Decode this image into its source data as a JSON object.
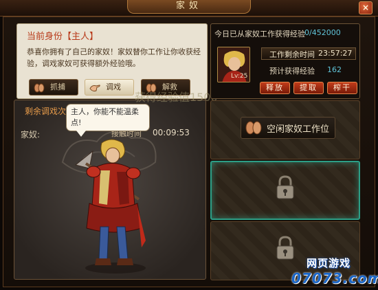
{
  "window": {
    "title": "家奴",
    "close_glyph": "×"
  },
  "info": {
    "identity": "当前身份【主人】",
    "intro": "恭喜你拥有了自己的家奴！家奴替你工作让你收获经验，调戏家奴可获得额外经验哦。"
  },
  "tabs": [
    {
      "label": "抓捕",
      "icon": "grab-hand-icon",
      "active": false
    },
    {
      "label": "调戏",
      "icon": "tease-hand-icon",
      "active": true
    },
    {
      "label": "解救",
      "icon": "rescue-hand-icon",
      "active": false
    }
  ],
  "overlay_text": "获得经验值1500",
  "servant": {
    "tease_label": "剩余调戏次数",
    "servant_label": "家奴:",
    "mini_tag": "接触时间",
    "timer": "00:09:53",
    "speech": "主人，你能不能温柔点!"
  },
  "exp": {
    "text": "今日已从家奴工作获得经验",
    "count": "0/452000",
    "level": "Lv:25",
    "work_label": "工作剩余时间",
    "work_time": "23:57:27",
    "est_label": "预计获得经验",
    "est_value": "162",
    "buttons": {
      "release": "释放",
      "extract": "提取",
      "squeeze": "榨干"
    }
  },
  "slots": {
    "idle_label": "空闲家奴工作位"
  },
  "watermark": {
    "top": "网页游戏",
    "bottom": "07073.com"
  },
  "colors": {
    "accent_cyan": "#60c4d8",
    "button_red": "#c23c1a",
    "identity_red": "#b83a1a",
    "highlight_teal": "#2c9e86"
  }
}
